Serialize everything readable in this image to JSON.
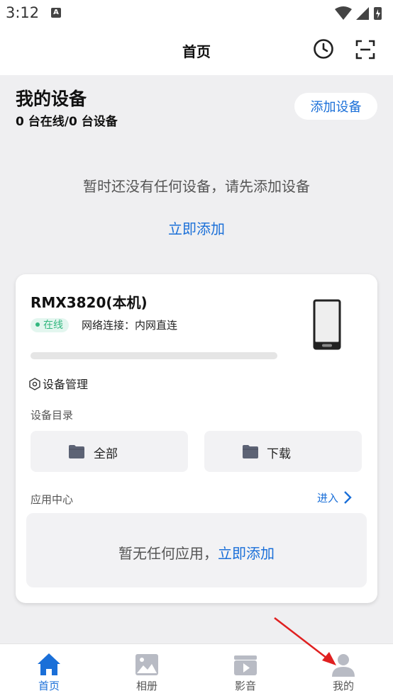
{
  "status_bar": {
    "time": "3:12",
    "notification_icon": "A"
  },
  "app_bar": {
    "title": "首页",
    "icons": [
      "history-icon",
      "scan-icon"
    ]
  },
  "devices": {
    "title": "我的设备",
    "summary": "0 台在线/0 台设备",
    "add_button": "添加设备",
    "empty_message": "暂时还没有任何设备，请先添加设备",
    "add_now": "立即添加"
  },
  "local_device": {
    "name": "RMX3820(本机)",
    "status": "在线",
    "network": "网络连接：内网直连",
    "storage_fraction": 0,
    "manage_label": "设备管理",
    "directory_label": "设备目录",
    "directories": [
      {
        "label": "全部"
      },
      {
        "label": "下载"
      }
    ],
    "app_center_label": "应用中心",
    "enter_label": "进入",
    "apps_empty_prefix": "暂无任何应用，",
    "apps_empty_link": "立即添加"
  },
  "tabs": [
    {
      "label": "首页",
      "icon": "home-icon",
      "active": true
    },
    {
      "label": "相册",
      "icon": "photo-icon",
      "active": false
    },
    {
      "label": "影音",
      "icon": "video-icon",
      "active": false
    },
    {
      "label": "我的",
      "icon": "profile-icon",
      "active": false
    }
  ],
  "colors": {
    "accent": "#1a6fd8",
    "online": "#33b77f",
    "background": "#efeff1"
  }
}
